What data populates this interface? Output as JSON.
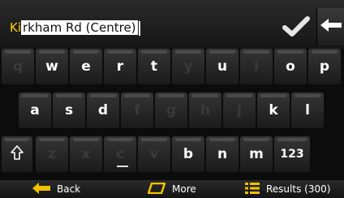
{
  "search": {
    "typed_prefix": "Ki",
    "suggested_suffix": "rkham Rd (Centre)"
  },
  "keyboard": {
    "row1": [
      {
        "label": "q",
        "enabled": false
      },
      {
        "label": "w",
        "enabled": true
      },
      {
        "label": "e",
        "enabled": true
      },
      {
        "label": "r",
        "enabled": true
      },
      {
        "label": "t",
        "enabled": true
      },
      {
        "label": "y",
        "enabled": false
      },
      {
        "label": "u",
        "enabled": true
      },
      {
        "label": "i",
        "enabled": false
      },
      {
        "label": "o",
        "enabled": true
      },
      {
        "label": "p",
        "enabled": true
      }
    ],
    "row2": [
      {
        "label": "a",
        "enabled": true
      },
      {
        "label": "s",
        "enabled": true
      },
      {
        "label": "d",
        "enabled": true
      },
      {
        "label": "f",
        "enabled": false
      },
      {
        "label": "g",
        "enabled": false
      },
      {
        "label": "h",
        "enabled": false
      },
      {
        "label": "j",
        "enabled": false
      },
      {
        "label": "k",
        "enabled": true
      },
      {
        "label": "l",
        "enabled": true
      }
    ],
    "row3": [
      {
        "label": "z",
        "enabled": false
      },
      {
        "label": "x",
        "enabled": false
      },
      {
        "label": "c",
        "enabled": false
      },
      {
        "label": "v",
        "enabled": false
      },
      {
        "label": "b",
        "enabled": true
      },
      {
        "label": "n",
        "enabled": true
      },
      {
        "label": "m",
        "enabled": true
      }
    ],
    "numbers_label": "123"
  },
  "bottom": {
    "back_label": "Back",
    "more_label": "More",
    "results_label": "Results (300)"
  },
  "colors": {
    "typed": "#ffd200",
    "accent_yellow": "#f2c200"
  }
}
